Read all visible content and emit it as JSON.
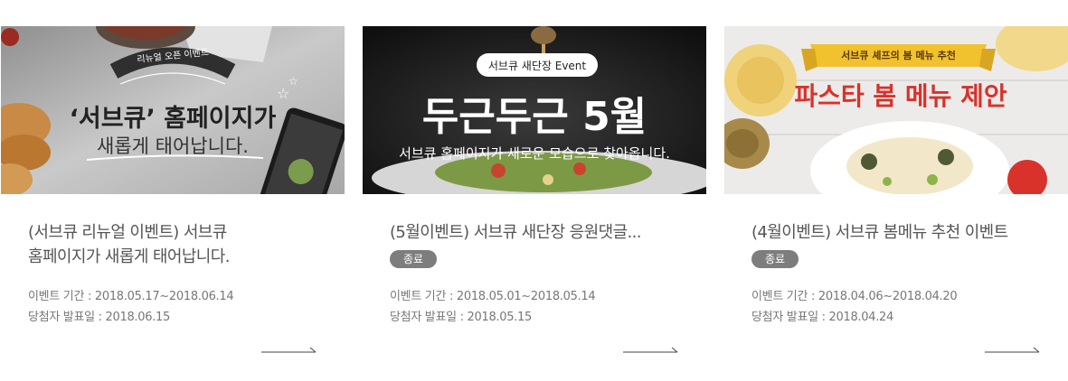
{
  "events": [
    {
      "thumb_lines": [
        "리뉴얼 오픈 이벤트",
        "‘서브큐’ 홈페이지가",
        "새롭게 태어납니다."
      ],
      "title": "(서브큐 리뉴얼 이벤트) 서브큐\n홈페이지가 새롭게 태어납니다.",
      "status": "",
      "period": "이벤트 기간 : 2018.05.17~2018.06.14",
      "announce": "당첨자 발표일 : 2018.06.15"
    },
    {
      "thumb_lines": [
        "서브큐 새단장 Event",
        "두근두근 5월",
        "서브큐 홈페이지가 새로운 모습으로 찾아옵니다."
      ],
      "title": "(5월이벤트) 서브큐 새단장 응원댓글...",
      "status": "종료",
      "period": "이벤트 기간 : 2018.05.01~2018.05.14",
      "announce": "당첨자 발표일 : 2018.05.15"
    },
    {
      "thumb_lines": [
        "서브큐 셰프의 봄 메뉴 추천",
        "파스타 봄 메뉴 제안"
      ],
      "title": "(4월이벤트) 서브큐 봄메뉴 추천 이벤트",
      "status": "종료",
      "period": "이벤트 기간 : 2018.04.06~2018.04.20",
      "announce": "당첨자 발표일 : 2018.04.24"
    }
  ],
  "colors": {
    "badge_bg": "#7d7d7d",
    "title_text": "#555555",
    "meta_text": "#777777",
    "ribbon_yellow": "#f2c12e",
    "banner_red": "#d8322b"
  },
  "icons": {
    "more": "arrow-right-icon"
  }
}
